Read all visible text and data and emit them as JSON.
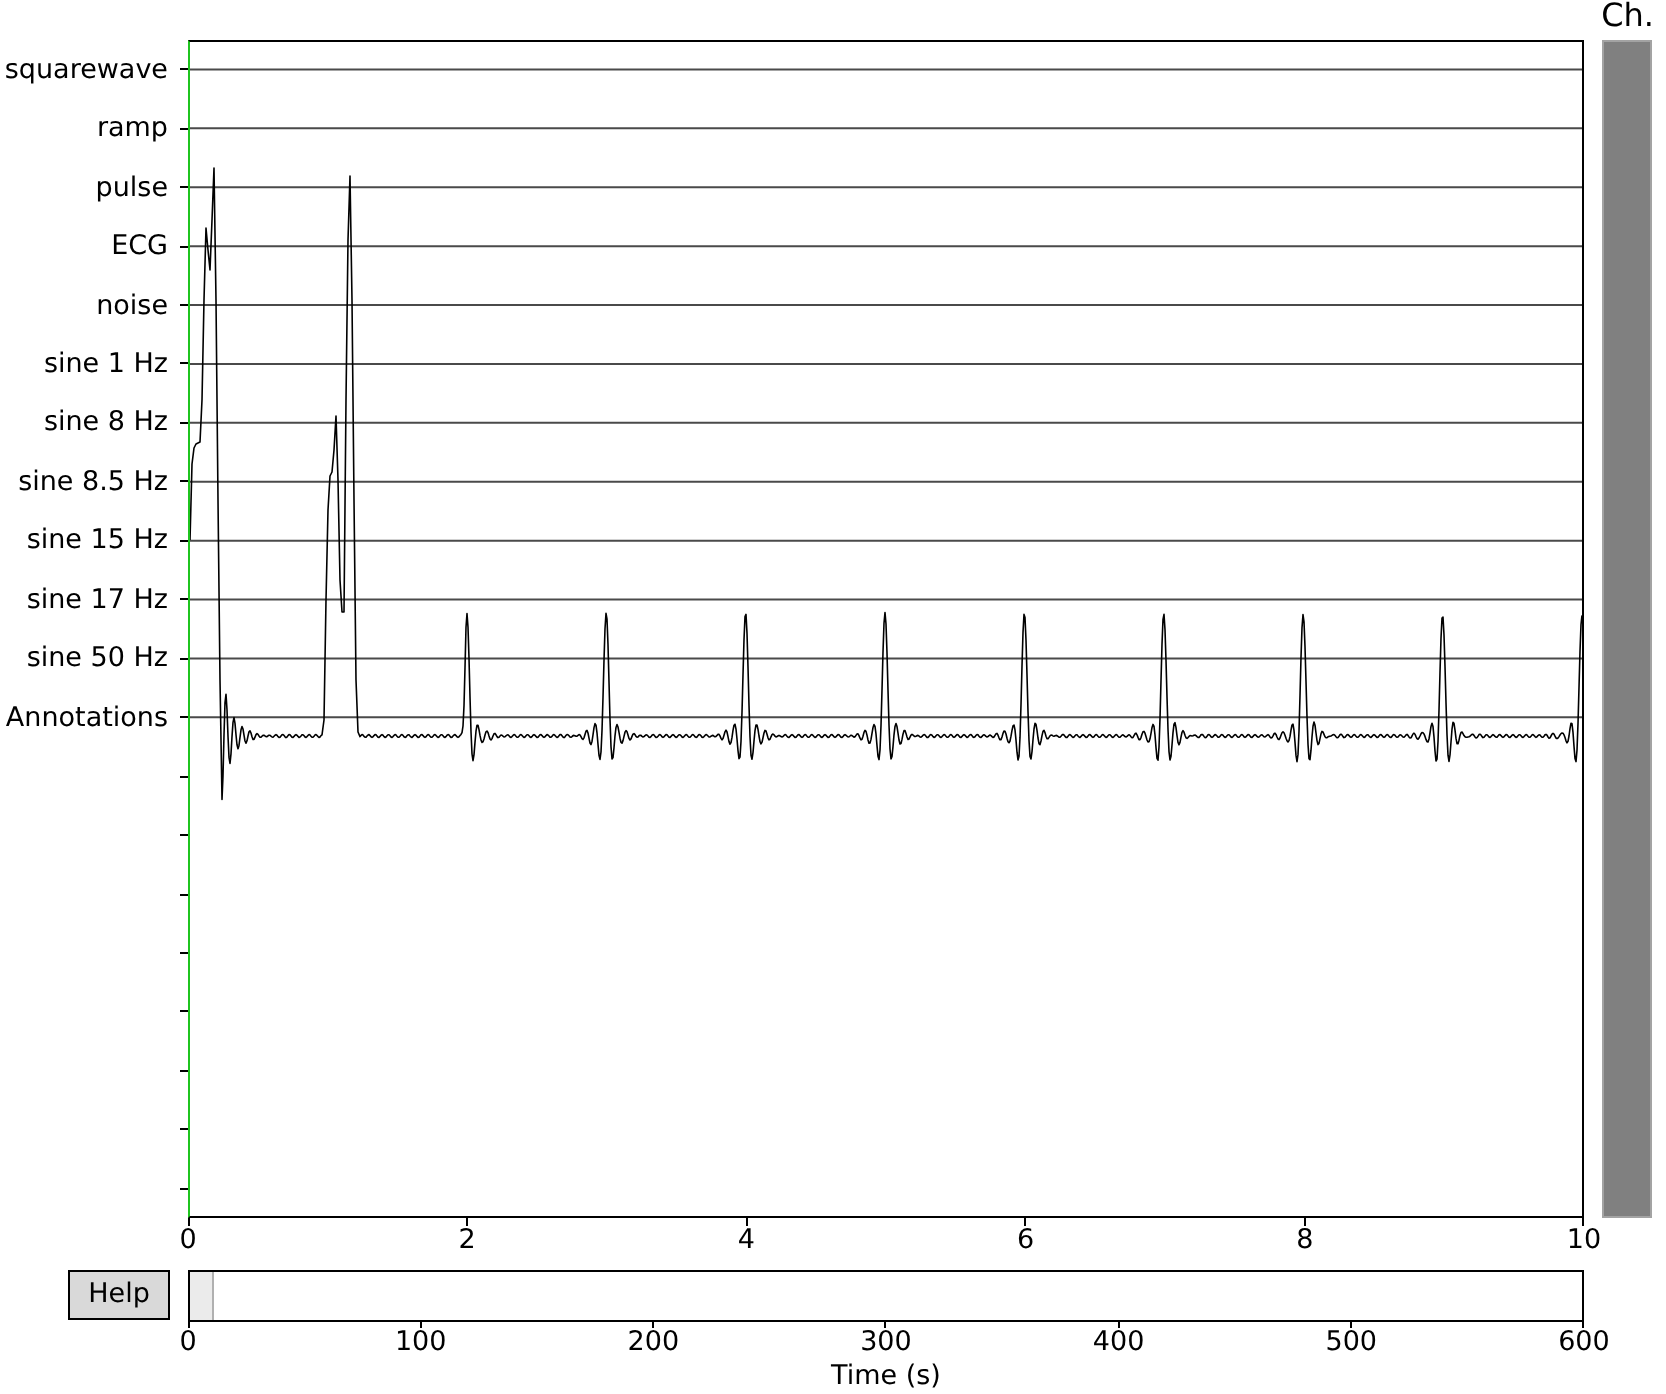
{
  "channel_scrollbar": {
    "label": "Ch."
  },
  "plot": {
    "channels": [
      "squarewave",
      "ramp",
      "pulse",
      "ECG",
      "noise",
      "sine 1 Hz",
      "sine 8 Hz",
      "sine 8.5 Hz",
      "sine 15 Hz",
      "sine 17 Hz",
      "sine 50 Hz",
      "Annotations"
    ],
    "time_ticks": [
      "0",
      "2",
      "4",
      "6",
      "8",
      "10"
    ]
  },
  "help_button": {
    "label": "Help"
  },
  "overview": {
    "ticks": [
      "0",
      "100",
      "200",
      "300",
      "400",
      "500",
      "600"
    ],
    "xlabel": "Time (s)"
  }
}
